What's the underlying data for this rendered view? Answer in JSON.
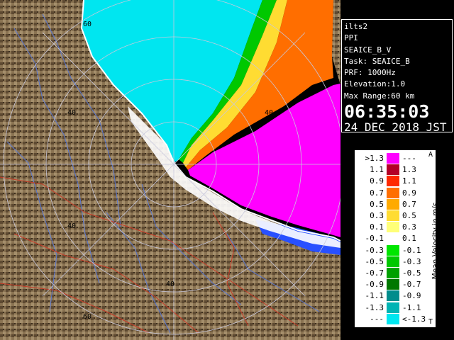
{
  "info": {
    "site": "ilts2",
    "product": "PPI",
    "task_name": "SEAICE_B_V",
    "task": "Task: SEAICE_B",
    "prf": "PRF: 1000Hz",
    "elevation": "Elevation:1.0",
    "max_range": "Max Range:60 km",
    "time": "06:35:03",
    "date": "24 DEC 2018 JST"
  },
  "rings": {
    "labels": [
      {
        "text": "60"
      },
      {
        "text": "40"
      },
      {
        "text": "40"
      },
      {
        "text": "40"
      },
      {
        "text": "40"
      },
      {
        "text": "60"
      }
    ]
  },
  "legend": {
    "title": "Mean Velocity in m/s",
    "top_mark": "A",
    "bottom_mark": "T",
    "rows": [
      {
        "lo": ">1.3",
        "hi": "---",
        "color": "#ff00ff"
      },
      {
        "lo": "1.1",
        "hi": "1.3",
        "color": "#b40028"
      },
      {
        "lo": "0.9",
        "hi": "1.1",
        "color": "#ff2800"
      },
      {
        "lo": "0.7",
        "hi": "0.9",
        "color": "#ff6e00"
      },
      {
        "lo": "0.5",
        "hi": "0.7",
        "color": "#ffaa00"
      },
      {
        "lo": "0.3",
        "hi": "0.5",
        "color": "#ffdc32"
      },
      {
        "lo": "0.1",
        "hi": "0.3",
        "color": "#ffff78"
      },
      {
        "lo": "-0.1",
        "hi": "0.1",
        "color": "#ffffff"
      },
      {
        "lo": "-0.3",
        "hi": "-0.1",
        "color": "#00e600"
      },
      {
        "lo": "-0.5",
        "hi": "-0.3",
        "color": "#00c800"
      },
      {
        "lo": "-0.7",
        "hi": "-0.5",
        "color": "#00a000"
      },
      {
        "lo": "-0.9",
        "hi": "-0.7",
        "color": "#007800"
      },
      {
        "lo": "-1.1",
        "hi": "-0.9",
        "color": "#008c8c"
      },
      {
        "lo": "-1.3",
        "hi": "-1.1",
        "color": "#00b4b4"
      },
      {
        "lo": "---",
        "hi": "<-1.3",
        "color": "#00e6f0"
      }
    ]
  },
  "colors": {
    "land": "#8a7352",
    "land_dark": "#4e3d28",
    "approach": "#00e6f0",
    "recede": "#ff00ff",
    "coast": "#ffffff",
    "river": "#5a78d2",
    "road": "#c83c28",
    "grid": "#c8c8dc"
  }
}
